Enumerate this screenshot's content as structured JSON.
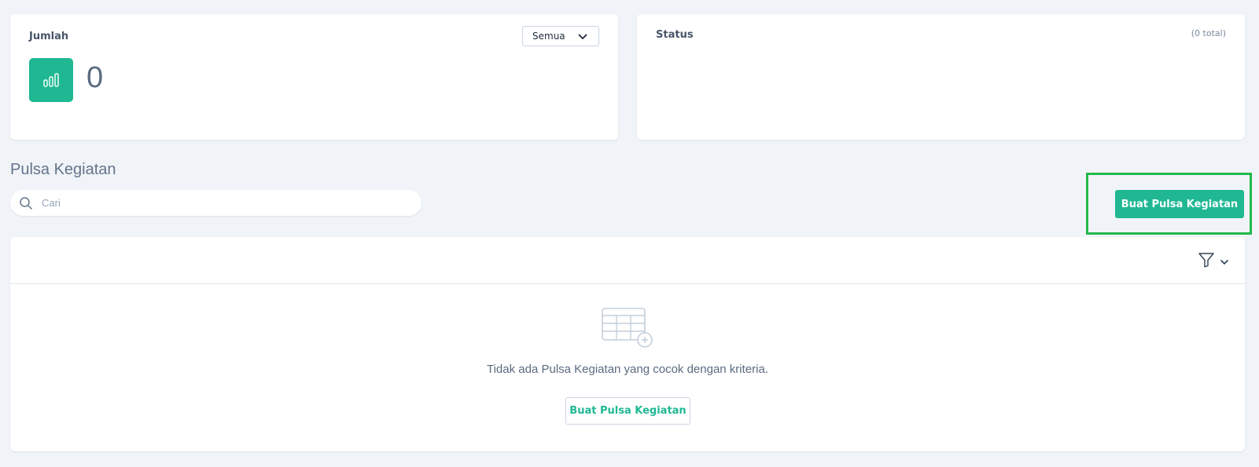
{
  "stats": {
    "jumlah": {
      "title": "Jumlah",
      "filter_selected": "Semua",
      "value": "0",
      "icon": "bar-chart-icon",
      "icon_bg": "#1fb893"
    },
    "status": {
      "title": "Status",
      "total_text": "(0 total)"
    }
  },
  "section": {
    "title": "Pulsa Kegiatan"
  },
  "search": {
    "placeholder": "Cari",
    "value": ""
  },
  "actions": {
    "create_label": "Buat Pulsa Kegiatan"
  },
  "table": {
    "filter_icon": "filter-icon",
    "empty_message": "Tidak ada Pulsa Kegiatan yang cocok dengan kriteria.",
    "empty_create_label": "Buat Pulsa Kegiatan"
  },
  "colors": {
    "accent": "#1fb893",
    "highlight": "#22b84a",
    "background": "#f0f4f8"
  }
}
